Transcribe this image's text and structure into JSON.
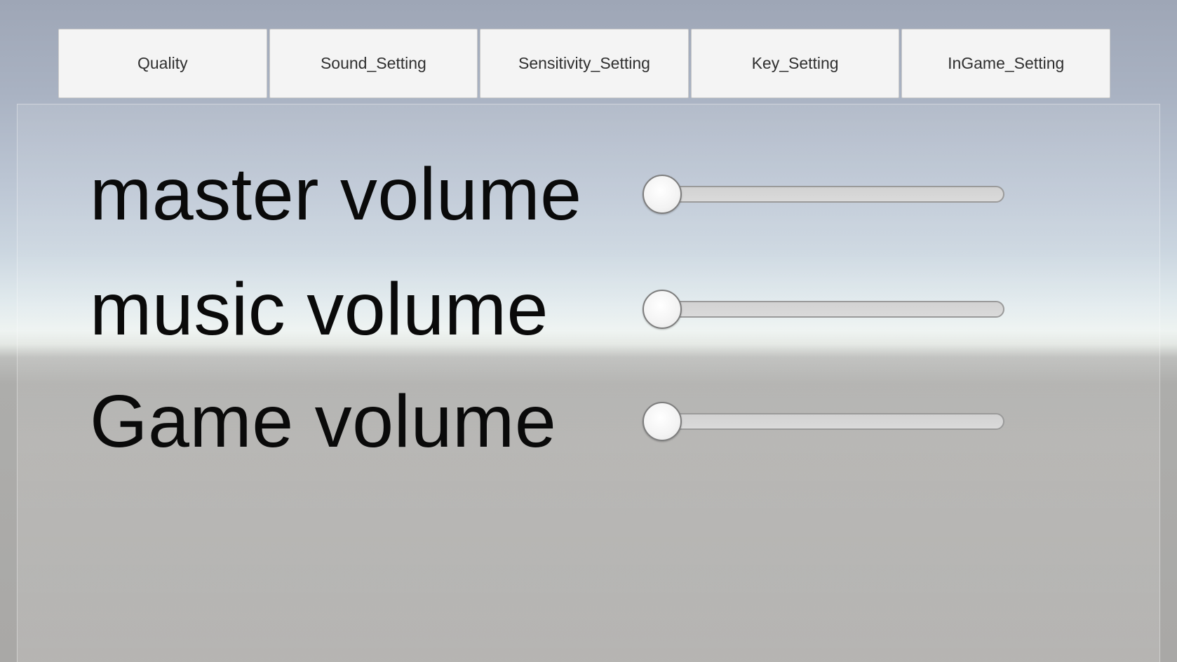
{
  "tabs": [
    {
      "label": "Quality"
    },
    {
      "label": "Sound_Setting"
    },
    {
      "label": "Sensitivity_Setting"
    },
    {
      "label": "Key_Setting"
    },
    {
      "label": "InGame_Setting"
    }
  ],
  "sound": {
    "rows": [
      {
        "label": "master volume",
        "value": 0
      },
      {
        "label": "music volume",
        "value": 0
      },
      {
        "label": "Game volume",
        "value": 0
      }
    ]
  },
  "colors": {
    "tab_background": "#f4f4f4",
    "tab_text": "#2f2f2f",
    "label_text": "#0a0a0a",
    "slider_track": "#d2d2d2",
    "slider_handle": "#ffffff"
  }
}
